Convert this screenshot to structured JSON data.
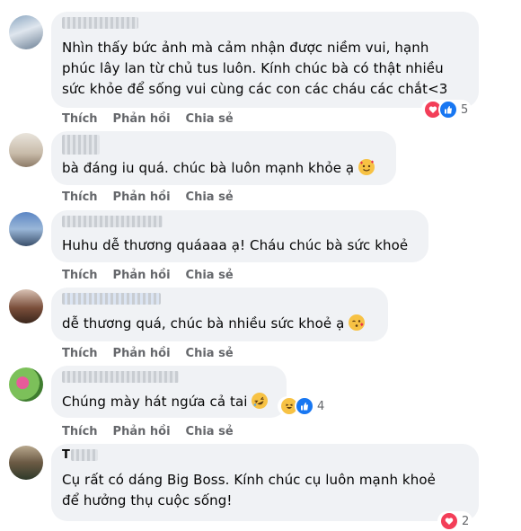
{
  "actions": {
    "like": "Thích",
    "reply": "Phản hồi",
    "share": "Chia sẻ"
  },
  "comments": [
    {
      "text": "Nhìn thấy bức ảnh mà cảm nhận được niềm vui, hạnh\nphúc lây lan từ chủ tus luôn. Kính chúc bà có thật nhiều\nsức khỏe để sống vui cùng các con các cháu các chắt<3",
      "reaction_icons": [
        "heart-icon",
        "like-icon"
      ],
      "reaction_count": "5"
    },
    {
      "text": "bà đáng iu quá. chúc bà luôn mạnh khỏe ạ",
      "emoji": "smiling-face-with-hearts-emoji"
    },
    {
      "text": "Huhu dễ thương quáaaa ạ! Cháu chúc bà sức khoẻ"
    },
    {
      "text": "dễ thương quá, chúc bà nhiều sức khoẻ ạ",
      "emoji": "face-blowing-kiss-emoji"
    },
    {
      "text": "Chúng mày hát ngứa cả tai",
      "emoji": "rolling-on-floor-laughing-emoji",
      "reaction_icons": [
        "haha-icon",
        "like-icon"
      ],
      "reaction_count": "4"
    },
    {
      "name_initial": "T",
      "text": "Cụ rất có dáng Big Boss. Kính chúc cụ luôn mạnh khoẻ\nđể hưởng thụ cuộc sống!",
      "reaction_icons": [
        "heart-icon"
      ],
      "reaction_count": "2"
    }
  ],
  "colors": {
    "bubble": "#f0f2f5",
    "action_text": "#65676b",
    "like_blue": "#1877f2",
    "heart_red": "#f33e58",
    "haha_yellow": "#f7c244"
  }
}
